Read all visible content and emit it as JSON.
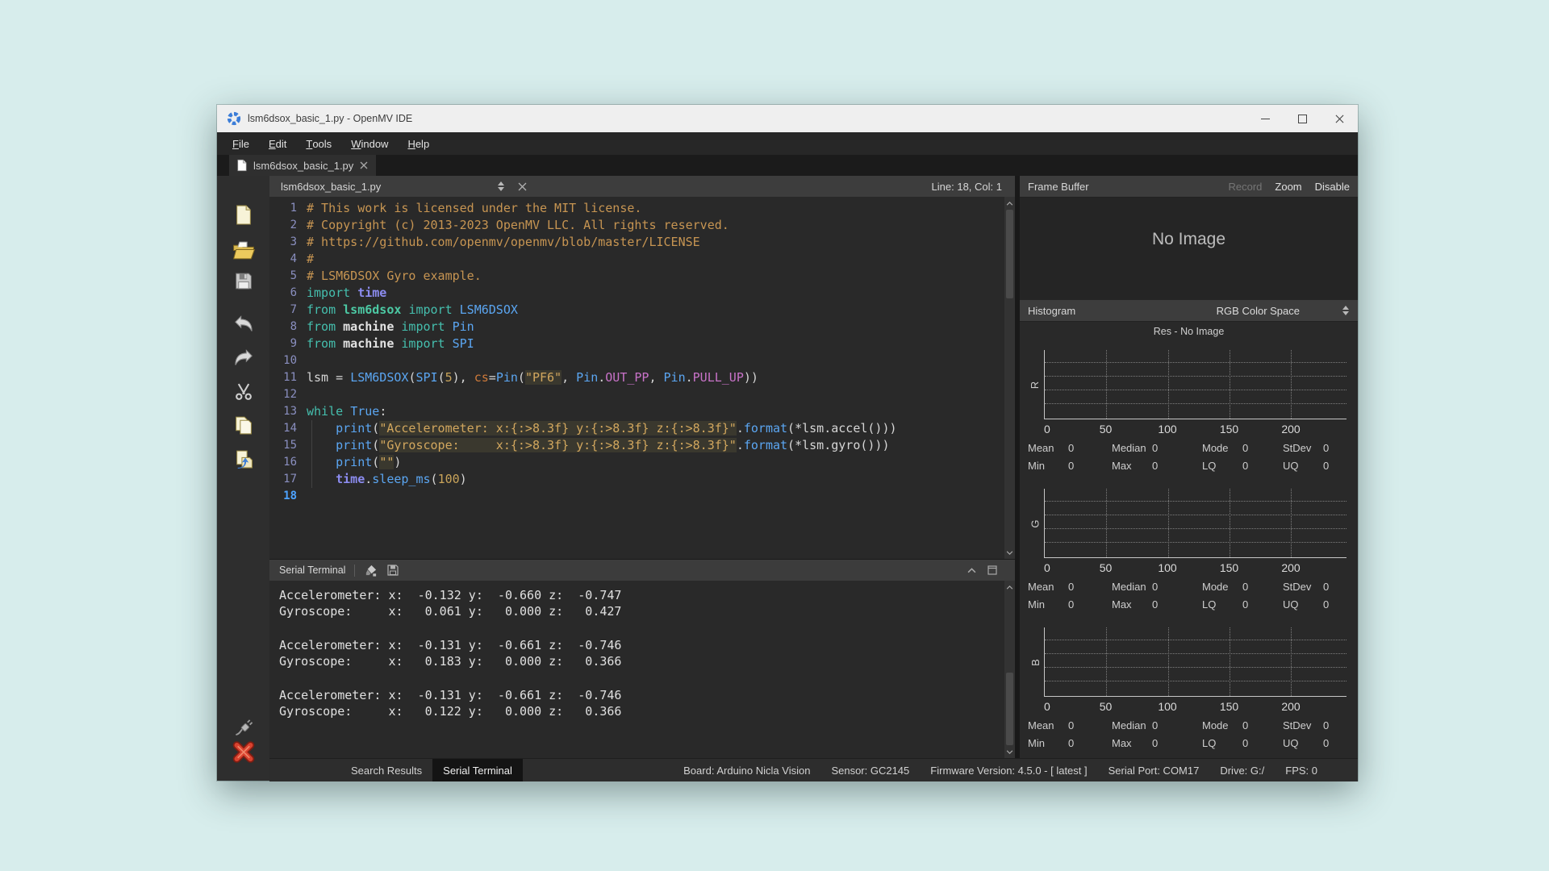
{
  "window": {
    "title": "lsm6dsox_basic_1.py - OpenMV IDE"
  },
  "menu_bar": {
    "items": [
      [
        "F",
        "ile"
      ],
      [
        "E",
        "dit"
      ],
      [
        "T",
        "ools"
      ],
      [
        "W",
        "indow"
      ],
      [
        "H",
        "elp"
      ]
    ]
  },
  "tab_bar": {
    "tabs": [
      {
        "label": "lsm6dsox_basic_1.py",
        "active": true
      }
    ]
  },
  "editor": {
    "doc_selector": "lsm6dsox_basic_1.py",
    "cursor_status": "Line: 18, Col: 1",
    "current_line": 18,
    "code": [
      {
        "n": 1,
        "t": [
          [
            "comment",
            "# This work is licensed under the MIT license."
          ]
        ]
      },
      {
        "n": 2,
        "t": [
          [
            "comment",
            "# Copyright (c) 2013-2023 OpenMV LLC. All rights reserved."
          ]
        ]
      },
      {
        "n": 3,
        "t": [
          [
            "comment",
            "# https://github.com/openmv/openmv/blob/master/LICENSE"
          ]
        ]
      },
      {
        "n": 4,
        "t": [
          [
            "comment",
            "#"
          ]
        ]
      },
      {
        "n": 5,
        "t": [
          [
            "comment",
            "# LSM6DSOX Gyro example."
          ]
        ]
      },
      {
        "n": 6,
        "t": [
          [
            "kw",
            "import"
          ],
          [
            "plain",
            " "
          ],
          [
            "module",
            "time"
          ]
        ]
      },
      {
        "n": 7,
        "t": [
          [
            "kw",
            "from"
          ],
          [
            "plain",
            " "
          ],
          [
            "module-green",
            "lsm6dsox"
          ],
          [
            "plain",
            " "
          ],
          [
            "kw",
            "import"
          ],
          [
            "plain",
            " "
          ],
          [
            "type",
            "LSM6DSOX"
          ]
        ]
      },
      {
        "n": 8,
        "t": [
          [
            "kw",
            "from"
          ],
          [
            "plain",
            " "
          ],
          [
            "module-bold",
            "machine"
          ],
          [
            "plain",
            " "
          ],
          [
            "kw",
            "import"
          ],
          [
            "plain",
            " "
          ],
          [
            "type",
            "Pin"
          ]
        ]
      },
      {
        "n": 9,
        "t": [
          [
            "kw",
            "from"
          ],
          [
            "plain",
            " "
          ],
          [
            "module-bold",
            "machine"
          ],
          [
            "plain",
            " "
          ],
          [
            "kw",
            "import"
          ],
          [
            "plain",
            " "
          ],
          [
            "type",
            "SPI"
          ]
        ]
      },
      {
        "n": 10,
        "t": []
      },
      {
        "n": 11,
        "t": [
          [
            "plain",
            "lsm = "
          ],
          [
            "type",
            "LSM6DSOX"
          ],
          [
            "plain",
            "("
          ],
          [
            "type",
            "SPI"
          ],
          [
            "plain",
            "("
          ],
          [
            "num",
            "5"
          ],
          [
            "plain",
            "), "
          ],
          [
            "kwarg",
            "cs"
          ],
          [
            "plain",
            "="
          ],
          [
            "type",
            "Pin"
          ],
          [
            "plain",
            "("
          ],
          [
            "str",
            "\"PF6\""
          ],
          [
            "plain",
            ", "
          ],
          [
            "type",
            "Pin"
          ],
          [
            "plain",
            "."
          ],
          [
            "attr",
            "OUT_PP"
          ],
          [
            "plain",
            ", "
          ],
          [
            "type",
            "Pin"
          ],
          [
            "plain",
            "."
          ],
          [
            "attr",
            "PULL_UP"
          ],
          [
            "plain",
            "))"
          ]
        ]
      },
      {
        "n": 12,
        "t": []
      },
      {
        "n": 13,
        "t": [
          [
            "kw",
            "while"
          ],
          [
            "plain",
            " "
          ],
          [
            "type",
            "True"
          ],
          [
            "plain",
            ":"
          ]
        ]
      },
      {
        "n": 14,
        "t": [
          [
            "plain",
            "    "
          ],
          [
            "type",
            "print"
          ],
          [
            "plain",
            "("
          ],
          [
            "str",
            "\"Accelerometer: x:{:>8.3f} y:{:>8.3f} z:{:>8.3f}\""
          ],
          [
            "plain",
            "."
          ],
          [
            "type",
            "format"
          ],
          [
            "plain",
            "(*lsm.accel()))"
          ]
        ]
      },
      {
        "n": 15,
        "t": [
          [
            "plain",
            "    "
          ],
          [
            "type",
            "print"
          ],
          [
            "plain",
            "("
          ],
          [
            "str",
            "\"Gyroscope:     x:{:>8.3f} y:{:>8.3f} z:{:>8.3f}\""
          ],
          [
            "plain",
            "."
          ],
          [
            "type",
            "format"
          ],
          [
            "plain",
            "(*lsm.gyro()))"
          ]
        ]
      },
      {
        "n": 16,
        "t": [
          [
            "plain",
            "    "
          ],
          [
            "type",
            "print"
          ],
          [
            "plain",
            "("
          ],
          [
            "str",
            "\"\""
          ],
          [
            "plain",
            ")"
          ]
        ]
      },
      {
        "n": 17,
        "t": [
          [
            "plain",
            "    "
          ],
          [
            "module",
            "time"
          ],
          [
            "plain",
            "."
          ],
          [
            "type",
            "sleep_ms"
          ],
          [
            "plain",
            "("
          ],
          [
            "num",
            "100"
          ],
          [
            "plain",
            ")"
          ]
        ]
      },
      {
        "n": 18,
        "t": []
      }
    ]
  },
  "frame_buffer": {
    "title": "Frame Buffer",
    "buttons": {
      "record": "Record",
      "zoom": "Zoom",
      "disable": "Disable"
    },
    "placeholder": "No Image"
  },
  "histogram": {
    "title": "Histogram",
    "color_space": "RGB Color Space",
    "resolution": "Res - No Image",
    "x_ticks": [
      "0",
      "50",
      "100",
      "150",
      "200"
    ],
    "channels": [
      {
        "label": "R",
        "stats_rows": [
          [
            [
              "Mean",
              "0"
            ],
            [
              "Median",
              "0"
            ],
            [
              "Mode",
              "0"
            ],
            [
              "StDev",
              "0"
            ]
          ],
          [
            [
              "Min",
              "0"
            ],
            [
              "Max",
              "0"
            ],
            [
              "LQ",
              "0"
            ],
            [
              "UQ",
              "0"
            ]
          ]
        ]
      },
      {
        "label": "G",
        "stats_rows": [
          [
            [
              "Mean",
              "0"
            ],
            [
              "Median",
              "0"
            ],
            [
              "Mode",
              "0"
            ],
            [
              "StDev",
              "0"
            ]
          ],
          [
            [
              "Min",
              "0"
            ],
            [
              "Max",
              "0"
            ],
            [
              "LQ",
              "0"
            ],
            [
              "UQ",
              "0"
            ]
          ]
        ]
      },
      {
        "label": "B",
        "stats_rows": [
          [
            [
              "Mean",
              "0"
            ],
            [
              "Median",
              "0"
            ],
            [
              "Mode",
              "0"
            ],
            [
              "StDev",
              "0"
            ]
          ],
          [
            [
              "Min",
              "0"
            ],
            [
              "Max",
              "0"
            ],
            [
              "LQ",
              "0"
            ],
            [
              "UQ",
              "0"
            ]
          ]
        ]
      }
    ]
  },
  "serial_terminal": {
    "title": "Serial Terminal",
    "blocks": [
      [
        "Accelerometer: x:  -0.132 y:  -0.660 z:  -0.747",
        "Gyroscope:     x:   0.061 y:   0.000 z:   0.427"
      ],
      [
        "Accelerometer: x:  -0.131 y:  -0.661 z:  -0.746",
        "Gyroscope:     x:   0.183 y:   0.000 z:   0.366"
      ],
      [
        "Accelerometer: x:  -0.131 y:  -0.661 z:  -0.746",
        "Gyroscope:     x:   0.122 y:   0.000 z:   0.366"
      ]
    ]
  },
  "status_bar": {
    "tabs": [
      {
        "label": "Search Results",
        "active": false
      },
      {
        "label": "Serial Terminal",
        "active": true
      }
    ],
    "fields": [
      "Board: Arduino Nicla Vision",
      "Sensor: GC2145",
      "Firmware Version: 4.5.0 - [ latest ]",
      "Serial Port: COM17",
      "Drive: G:/",
      "FPS: 0"
    ]
  },
  "colors": {
    "desktop_background": "#d7edec",
    "accent_blue": "#5ba6f2",
    "keyword_teal": "#45bfae",
    "comment_orange": "#c79552",
    "string_yellow": "#d2a75e",
    "error_red": "#d9412e"
  }
}
